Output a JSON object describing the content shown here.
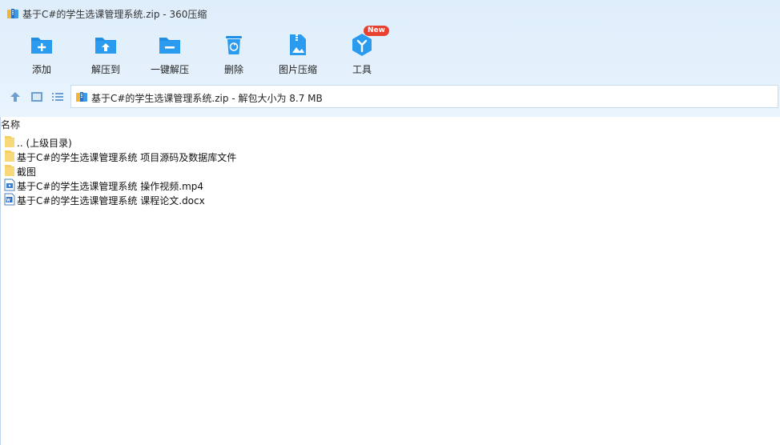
{
  "window": {
    "title": "基于C#的学生选课管理系统.zip - 360压缩"
  },
  "toolbar": {
    "items": [
      {
        "label": "添加",
        "icon": "add-icon"
      },
      {
        "label": "解压到",
        "icon": "extract-to-icon"
      },
      {
        "label": "一键解压",
        "icon": "one-click-extract-icon"
      },
      {
        "label": "删除",
        "icon": "delete-icon"
      },
      {
        "label": "图片压缩",
        "icon": "image-compress-icon"
      },
      {
        "label": "工具",
        "icon": "tools-icon"
      }
    ],
    "new_badge": "New"
  },
  "address_bar": {
    "text": "基于C#的学生选课管理系统.zip - 解包大小为 8.7 MB"
  },
  "file_list": {
    "column_name": "名称",
    "rows": [
      {
        "name": ".. (上级目录)",
        "icon": "folder-icon"
      },
      {
        "name": "基于C#的学生选课管理系统 项目源码及数据库文件",
        "icon": "folder-icon"
      },
      {
        "name": "截图",
        "icon": "folder-icon"
      },
      {
        "name": "基于C#的学生选课管理系统 操作视频.mp4",
        "icon": "video-file-icon"
      },
      {
        "name": "基于C#的学生选课管理系统 课程论文.docx",
        "icon": "word-file-icon"
      }
    ]
  },
  "colors": {
    "accent": "#1e8ee6",
    "toolbar_bg": "#e2f0fb",
    "folder": "#f5cf63",
    "badge": "#e8412f"
  }
}
